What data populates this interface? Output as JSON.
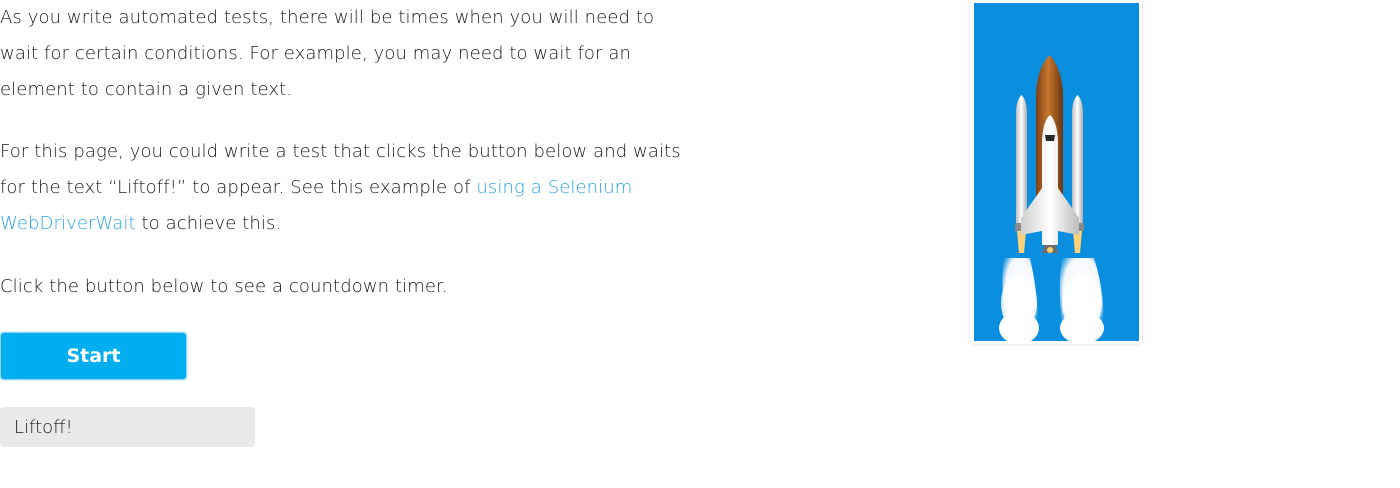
{
  "content": {
    "para1": "As you write automated tests, there will be times when you will need to wait for certain conditions. For example, you may need to wait for an element to contain a given text.",
    "para2_before": "For this page, you could write a test that clicks the button below and waits for the text “Liftoff!” to appear. See this example of ",
    "para2_link": "using a Selenium WebDriverWait",
    "para2_after": " to achieve this.",
    "para3": "Click the button below to see a countdown timer."
  },
  "start_button": {
    "label": "Start"
  },
  "result": {
    "text": "Liftoff!"
  },
  "image": {
    "subject": "space-shuttle-launch",
    "background_color": "#0a8fe0"
  },
  "colors": {
    "accent": "#00aeef",
    "link": "#2aa4e2",
    "result_bg": "#e9e9e9"
  }
}
